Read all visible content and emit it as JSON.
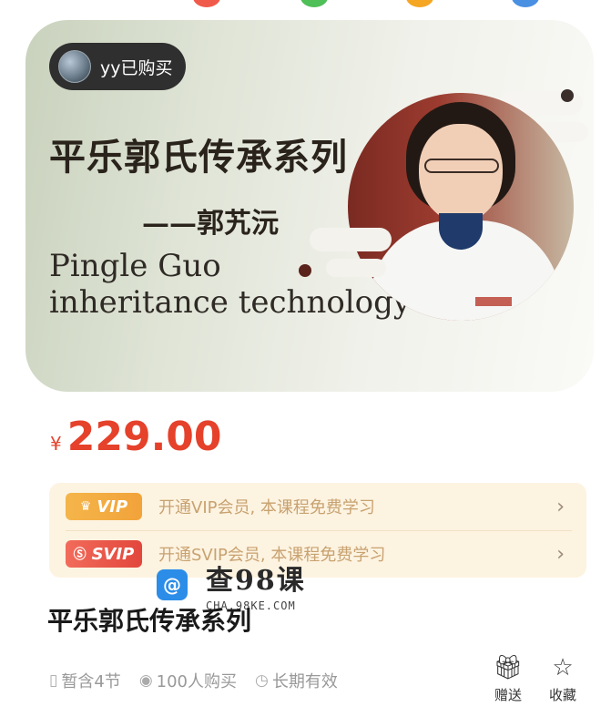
{
  "nav_dots": {
    "colors": [
      "#f05a4b",
      "#4fbf58",
      "#f5a623",
      "#4a90e2"
    ]
  },
  "banner": {
    "buyer_label": "yy已购买",
    "title_cn": "平乐郭氏传承系列",
    "author_line": "——郭艽沅",
    "title_en_line1": "Pingle  Guo",
    "title_en_line2": "inheritance  technology"
  },
  "price": {
    "currency": "¥",
    "amount": "229.00",
    "color": "#e5412b"
  },
  "vip": {
    "vip_badge": "VIP",
    "vip_text": "开通VIP会员, 本课程免费学习",
    "svip_badge": "SVIP",
    "svip_text": "开通SVIP会员, 本课程免费学习",
    "chevron": "›"
  },
  "watermark": {
    "title": "查98课",
    "subtitle": "CHA.98KE.COM"
  },
  "course": {
    "title": "平乐郭氏传承系列",
    "lessons": "暂含4节",
    "buyers": "100人购买",
    "validity": "长期有效"
  },
  "actions": {
    "gift_label": "赠送",
    "favorite_label": "收藏"
  },
  "icons": {
    "book": "book-icon",
    "eye": "eye-icon",
    "clock": "clock-icon",
    "gift": "gift-icon",
    "star": "star-icon"
  }
}
